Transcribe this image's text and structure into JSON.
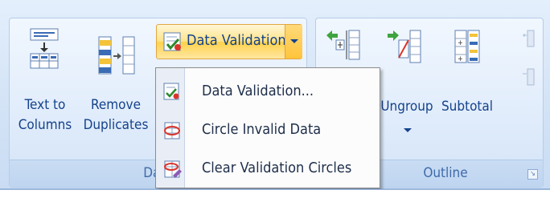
{
  "groups": {
    "data_tools": {
      "label": "Data",
      "text_to_columns": {
        "line1": "Text to",
        "line2": "Columns"
      },
      "remove_duplicates": {
        "line1": "Remove",
        "line2": "Duplicates"
      },
      "data_validation": {
        "label": "Data Validation"
      }
    },
    "outline": {
      "label": "Outline",
      "ungroup": {
        "label": "Ungroup"
      },
      "subtotal": {
        "label": "Subtotal"
      }
    }
  },
  "data_validation_menu": {
    "items": [
      {
        "label": "Data Validation...",
        "icon": "data-validation-icon"
      },
      {
        "label": "Circle Invalid Data",
        "icon": "circle-invalid-data-icon"
      },
      {
        "label": "Clear Validation Circles",
        "icon": "clear-validation-circles-icon"
      }
    ]
  },
  "colors": {
    "ribbon_text": "#15428b",
    "hover_highlight": "#ffd24c",
    "group_label": "#3e6aaa"
  }
}
